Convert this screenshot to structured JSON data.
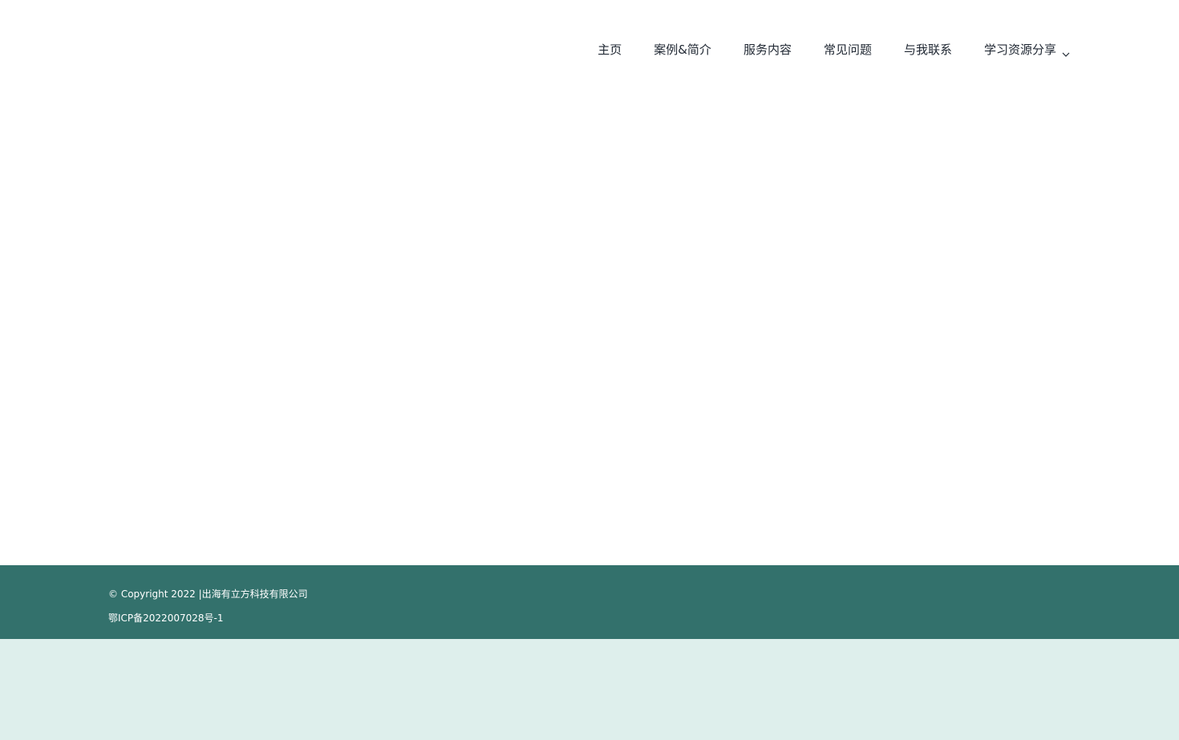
{
  "nav": {
    "items": [
      {
        "label": "主页"
      },
      {
        "label": "案例&简介"
      },
      {
        "label": "服务内容"
      },
      {
        "label": "常见问题"
      },
      {
        "label": "与我联系"
      },
      {
        "label": "学习资源分享",
        "icon": "chevron-down-icon"
      }
    ]
  },
  "footer": {
    "copyright": "© Copyright 2022 |出海有立方科技有限公司",
    "icp": "鄂ICP备2022007028号-1"
  },
  "colors": {
    "footer_bg": "#33716c",
    "bottom_band_bg": "#deefec",
    "nav_text": "#212934"
  }
}
